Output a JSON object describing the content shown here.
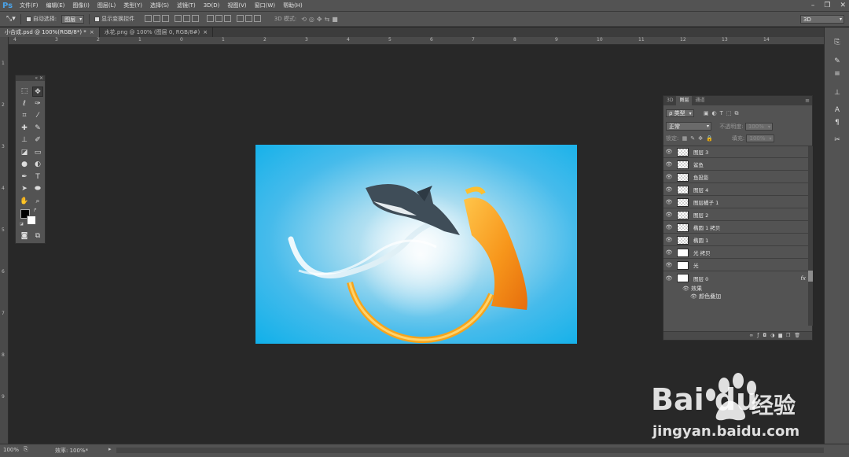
{
  "app": {
    "logo": "Ps"
  },
  "menu": [
    "文件(F)",
    "编辑(E)",
    "图像(I)",
    "图层(L)",
    "类型(Y)",
    "选择(S)",
    "滤镜(T)",
    "3D(D)",
    "视图(V)",
    "窗口(W)",
    "帮助(H)"
  ],
  "options": {
    "auto_select_label": "自动选择:",
    "auto_select_value": "图层",
    "show_transform_label": "显示变换控件",
    "mode_3d_label": "3D 模式:",
    "workspace": "3D"
  },
  "tabs": [
    {
      "label": "小合成.psd @ 100%(RGB/8*) *",
      "active": true
    },
    {
      "label": "水花.png @ 100% (图层 0, RGB/8#)",
      "active": false
    }
  ],
  "ruler": {
    "h_ticks": [
      "4",
      "3",
      "2",
      "1",
      "0",
      "1",
      "2",
      "3",
      "4",
      "5",
      "6",
      "7",
      "8",
      "9",
      "10",
      "11",
      "12",
      "13",
      "14"
    ],
    "v_ticks": [
      "1",
      "2",
      "3",
      "4",
      "5",
      "6",
      "7",
      "8",
      "9"
    ]
  },
  "layers_panel": {
    "tabs": [
      "3D",
      "图层",
      "通道"
    ],
    "active_tab": "图层",
    "filter_kind": "ρ 类型",
    "blend_mode": "正常",
    "opacity_label": "不透明度:",
    "opacity_value": "100%",
    "lock_label": "锁定:",
    "fill_label": "填充:",
    "fill_value": "100%",
    "layers": [
      {
        "name": "图层 3",
        "thumb": "checker"
      },
      {
        "name": "鲨鱼",
        "thumb": "checker"
      },
      {
        "name": "鱼投影",
        "thumb": "checker"
      },
      {
        "name": "图层 4",
        "thumb": "checker"
      },
      {
        "name": "图层橘子 1",
        "thumb": "checker"
      },
      {
        "name": "图层 2",
        "thumb": "checker"
      },
      {
        "name": "椭圆 1 拷贝",
        "thumb": "checker"
      },
      {
        "name": "椭圆 1",
        "thumb": "checker"
      },
      {
        "name": "光 拷贝",
        "thumb": "white"
      },
      {
        "name": "光",
        "thumb": "white"
      },
      {
        "name": "图层 0",
        "thumb": "white",
        "fx": "fx"
      }
    ],
    "effects_label": "效果",
    "effect_item": "颜色叠加"
  },
  "status": {
    "zoom": "100%",
    "efficiency": "效率: 100%*"
  },
  "watermark": {
    "brand": "Bai  du",
    "brand2": "经验",
    "url": "jingyan.baidu.com"
  },
  "colors": {
    "chrome": "#535353",
    "workspace": "#282828",
    "canvas_edge": "#10b0ea",
    "orange": "#f39a1e",
    "ps_blue": "#4ba3e8"
  }
}
